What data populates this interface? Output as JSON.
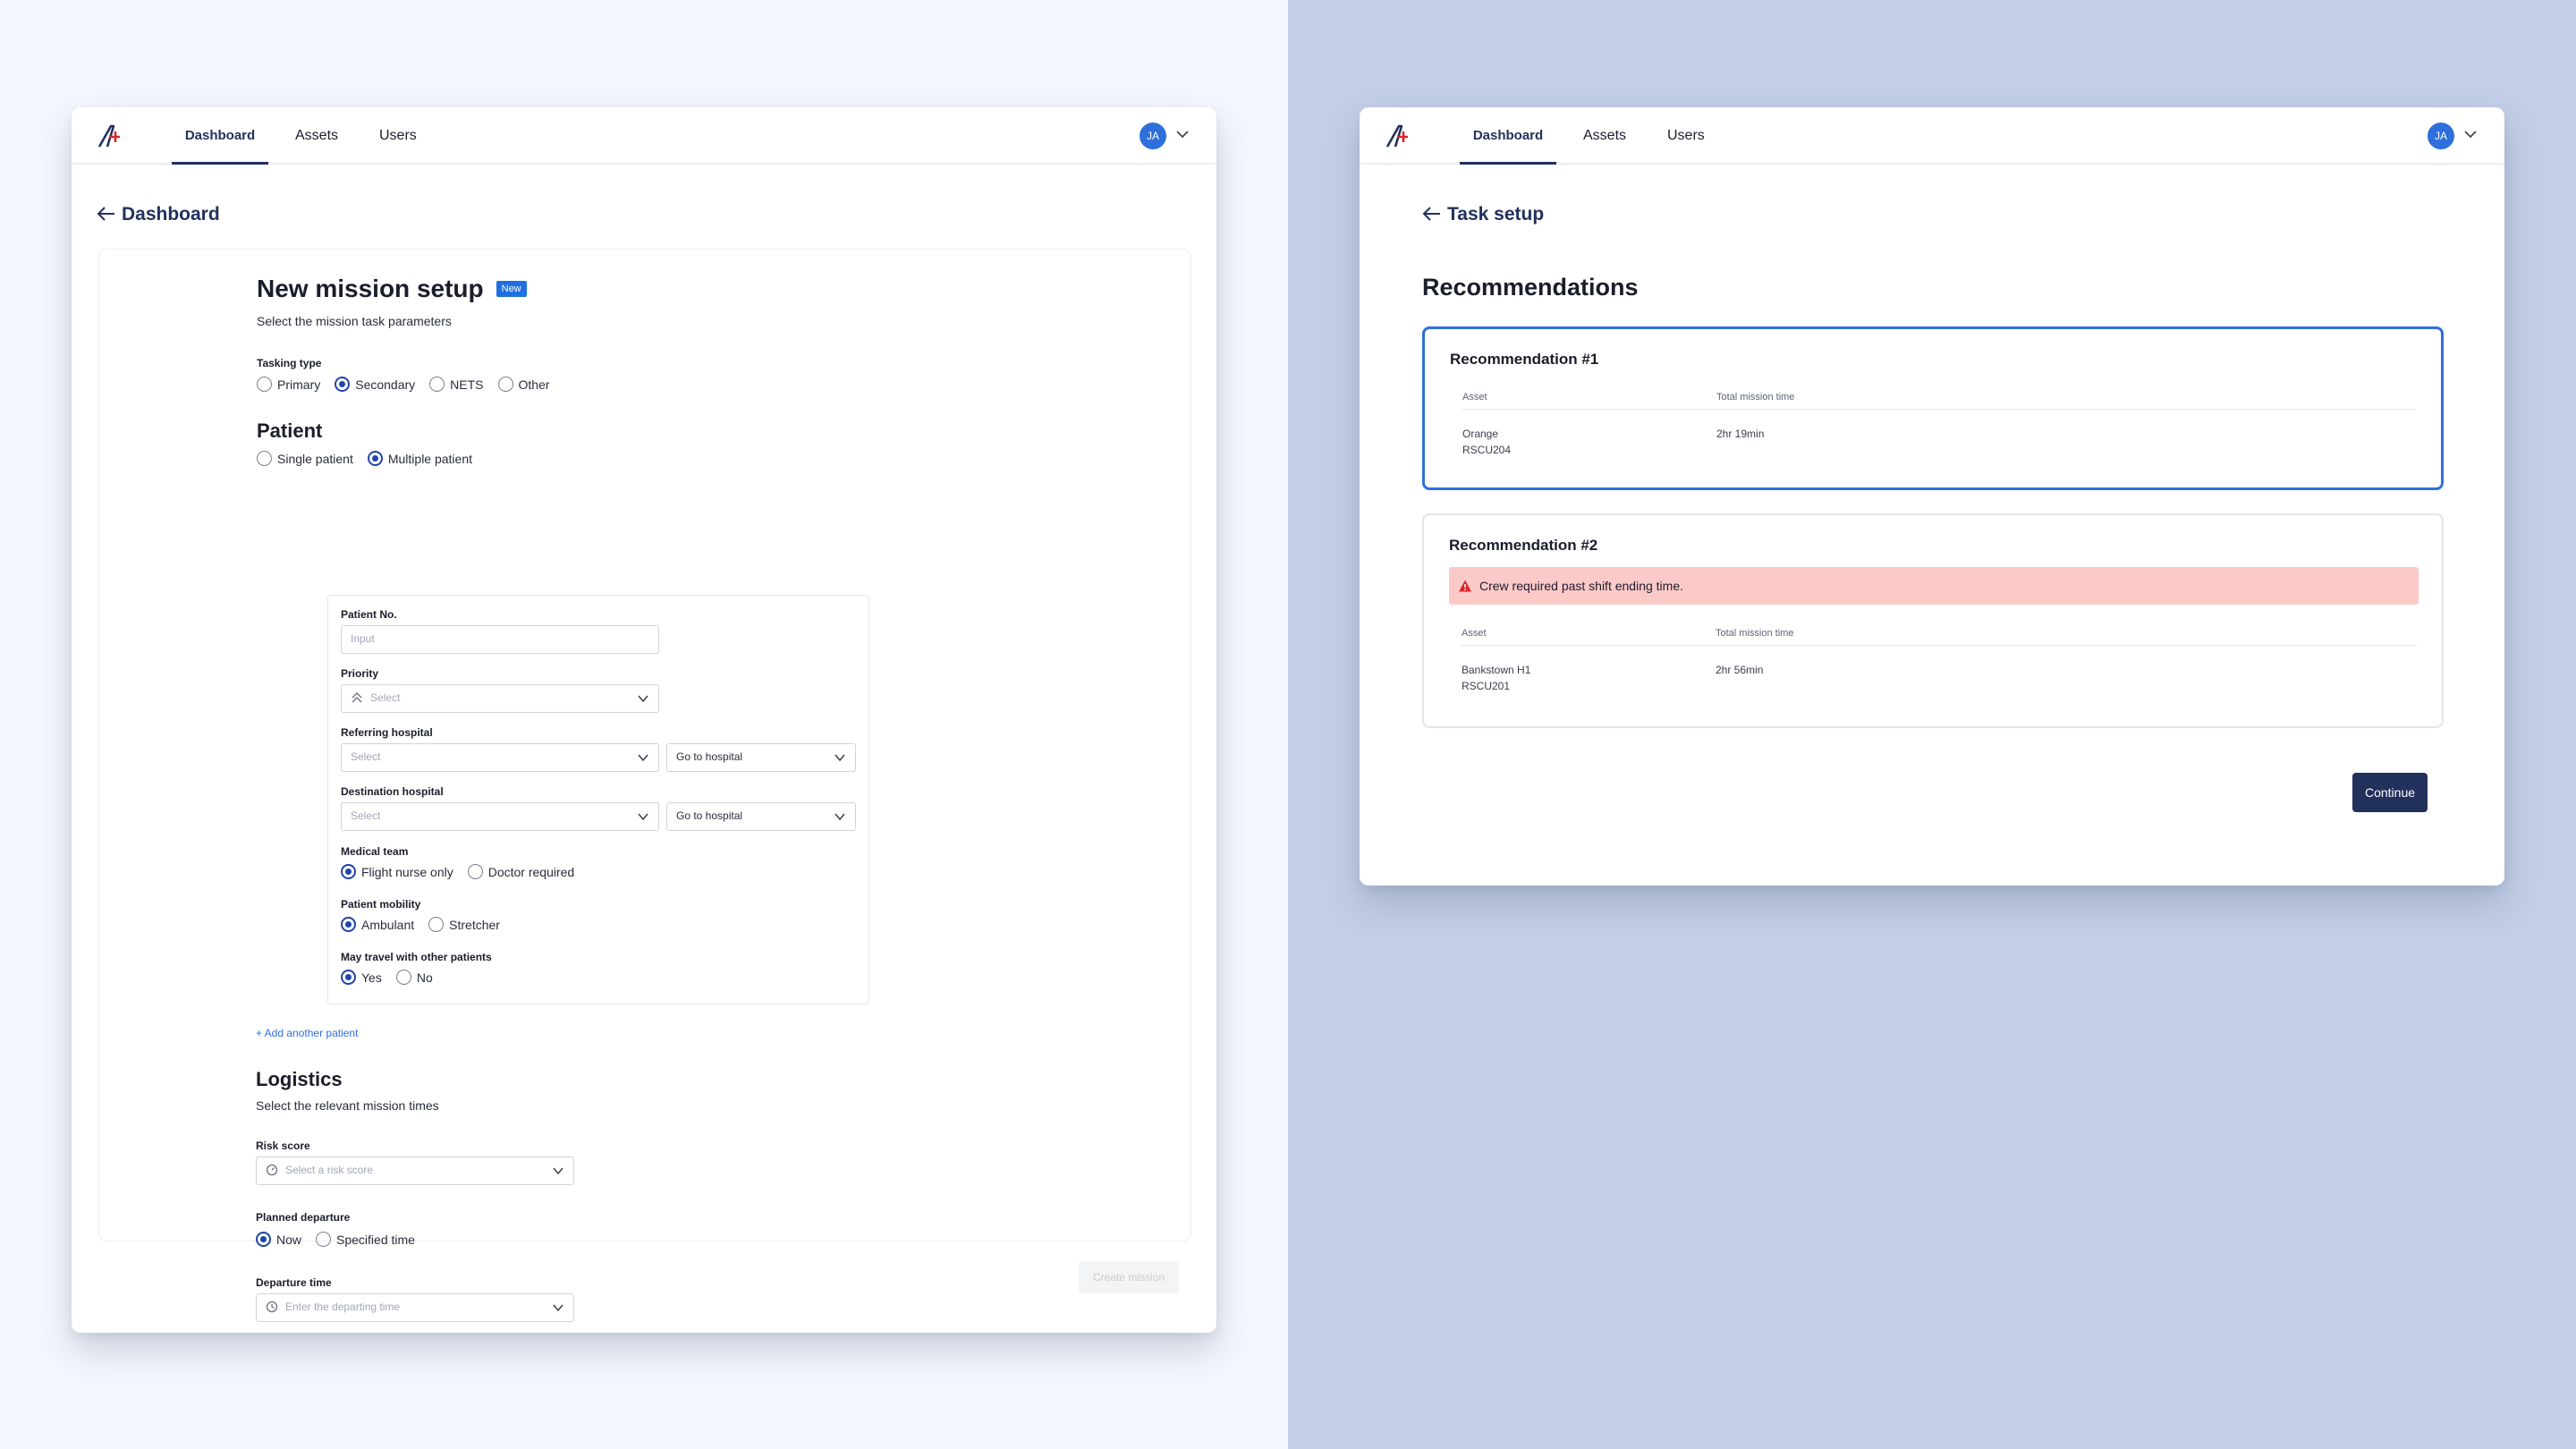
{
  "left_window": {
    "nav": {
      "tabs": [
        "Dashboard",
        "Assets",
        "Users"
      ],
      "active": "Dashboard",
      "avatar_initials": "JA"
    },
    "back_label": "Dashboard",
    "form": {
      "title": "New mission setup",
      "badge": "New",
      "subtitle": "Select the mission task parameters",
      "tasking_type": {
        "label": "Tasking type",
        "options": [
          "Primary",
          "Secondary",
          "NETS",
          "Other"
        ],
        "selected": "Secondary"
      },
      "patient": {
        "heading": "Patient",
        "options": [
          "Single patient",
          "Multiple patient"
        ],
        "selected": "Multiple patient",
        "patient_no": {
          "label": "Patient No.",
          "placeholder": "Input"
        },
        "priority": {
          "label": "Priority",
          "placeholder": "Select"
        },
        "referring_hospital": {
          "label": "Referring hospital",
          "placeholder": "Select",
          "action": "Go to hospital"
        },
        "destination_hospital": {
          "label": "Destination hospital",
          "placeholder": "Select",
          "action": "Go to hospital"
        },
        "medical_team": {
          "label": "Medical team",
          "options": [
            "Flight nurse only",
            "Doctor required"
          ],
          "selected": "Flight nurse only"
        },
        "patient_mobility": {
          "label": "Patient mobility",
          "options": [
            "Ambulant",
            "Stretcher"
          ],
          "selected": "Ambulant"
        },
        "travel_with_others": {
          "label": "May travel with other patients",
          "options": [
            "Yes",
            "No"
          ],
          "selected": "Yes"
        },
        "add_another": "+ Add another patient"
      },
      "logistics": {
        "heading": "Logistics",
        "subtitle": "Select the relevant mission times",
        "risk_score": {
          "label": "Risk score",
          "placeholder": "Select a risk score"
        },
        "planned_departure": {
          "label": "Planned departure",
          "options": [
            "Now",
            "Specified time"
          ],
          "selected": "Now"
        },
        "departure_time": {
          "label": "Departure time",
          "placeholder": "Enter the departing time"
        }
      },
      "submit_label": "Create mission"
    }
  },
  "right_window": {
    "nav": {
      "tabs": [
        "Dashboard",
        "Assets",
        "Users"
      ],
      "active": "Dashboard",
      "avatar_initials": "JA"
    },
    "back_label": "Task setup",
    "heading": "Recommendations",
    "columns": [
      "Asset",
      "Total mission time"
    ],
    "recommendations": [
      {
        "title": "Recommendation #1",
        "asset_name": "Orange",
        "asset_code": "RSCU204",
        "total_time": "2hr 19min",
        "warning": ""
      },
      {
        "title": "Recommendation #2",
        "asset_name": "Bankstown H1",
        "asset_code": "RSCU201",
        "total_time": "2hr 56min",
        "warning": "Crew required past shift ending time."
      }
    ],
    "continue_label": "Continue"
  },
  "colors": {
    "accent": "#2f6fdb",
    "navy": "#22305c",
    "badge": "#1e6fe0",
    "alert_bg": "#fcc9c9",
    "right_bg": "#c3cfe6",
    "left_bg": "#f4f7fd"
  },
  "icons": [
    "logo-icon",
    "chevron-down-icon",
    "arrow-left-icon",
    "priority-icon",
    "risk-icon",
    "clock-icon",
    "warning-icon"
  ]
}
